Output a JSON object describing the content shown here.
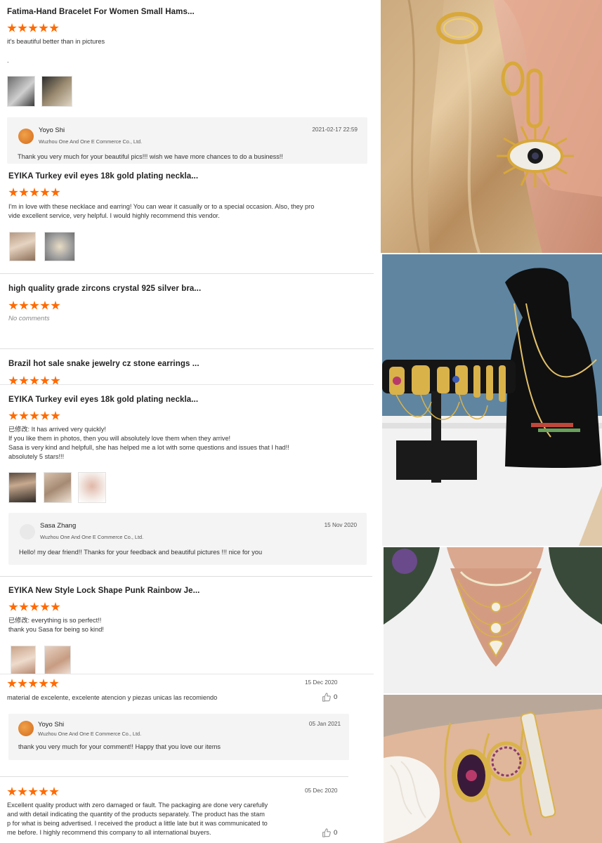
{
  "reviews": {
    "r1": {
      "title": "Fatima-Hand Bracelet For Women Small Hams...",
      "text": "it's beautiful better than in pictures",
      "dot": ".",
      "reply": {
        "name": "Yoyo Shi",
        "company": "Wuzhou One And One E Commerce Co., Ltd.",
        "date": "2021-02-17 22:59",
        "message": "Thank you very much for your beautiful pics!!! wish we have more chances to do a business!!"
      }
    },
    "r2": {
      "title": "EYIKA Turkey evil eyes 18k gold plating neckla...",
      "line1": "I'm in love with these necklace and earring! You can wear it casually or to a special occasion. Also, they pro",
      "line2": "vide excellent service, very helpful. I would highly recommend this vendor."
    },
    "r3": {
      "title": "high quality grade zircons crystal 925 silver bra...",
      "no_comments": "No comments"
    },
    "r4": {
      "title": "Brazil hot sale snake jewelry cz stone earrings ..."
    },
    "r5": {
      "title": "EYIKA Turkey evil eyes 18k gold plating neckla...",
      "line1": "已修改: It has arrived very quickly!",
      "line2": "If you like them in photos, then you will absolutely love them when they arrive!",
      "line3": "Sasa is very kind and helpfull, she has helped me a lot with some questions and issues that I had!!",
      "line4": "absolutely 5 stars!!!",
      "reply": {
        "name": "Sasa Zhang",
        "company": "Wuzhou One And One E Commerce Co., Ltd.",
        "date": "15 Nov 2020",
        "message": "Hello! my dear friend!!  Thanks for your feedback and beautiful pictures !!!  nice for you"
      }
    },
    "r6": {
      "title": "EYIKA New Style Lock Shape Punk Rainbow Je...",
      "line1": "已修改: everything is so perfect!!",
      "line2": "thank you Sasa for being so kind!"
    },
    "r7": {
      "date": "15 Dec 2020",
      "text": "material de excelente, excelente atencion y piezas unicas las recomiendo",
      "likes": "0",
      "reply": {
        "name": "Yoyo Shi",
        "company": "Wuzhou One And One E Commerce Co., Ltd.",
        "date": "05 Jan 2021",
        "message": "thank you very much for your comment!! Happy that you love our items"
      }
    },
    "r8": {
      "date": "05 Dec 2020",
      "line1": "Excellent quality product with zero damaged or fault. The packaging are done very carefully",
      "line2": "and with detail indicating the quantity of the products separately. The product has the stam",
      "line3": "p for what is being advertised. I received the product a little late but it was communicated to",
      "line4": "me before. I highly recommend this company to all international buyers.",
      "likes": "0"
    }
  },
  "rating": 5,
  "colors": {
    "star": "#ff6a00",
    "reply_bg": "#f4f4f4",
    "separator": "#dedede"
  },
  "icons": {
    "like": "thumbs-up-icon",
    "star": "star-icon"
  }
}
